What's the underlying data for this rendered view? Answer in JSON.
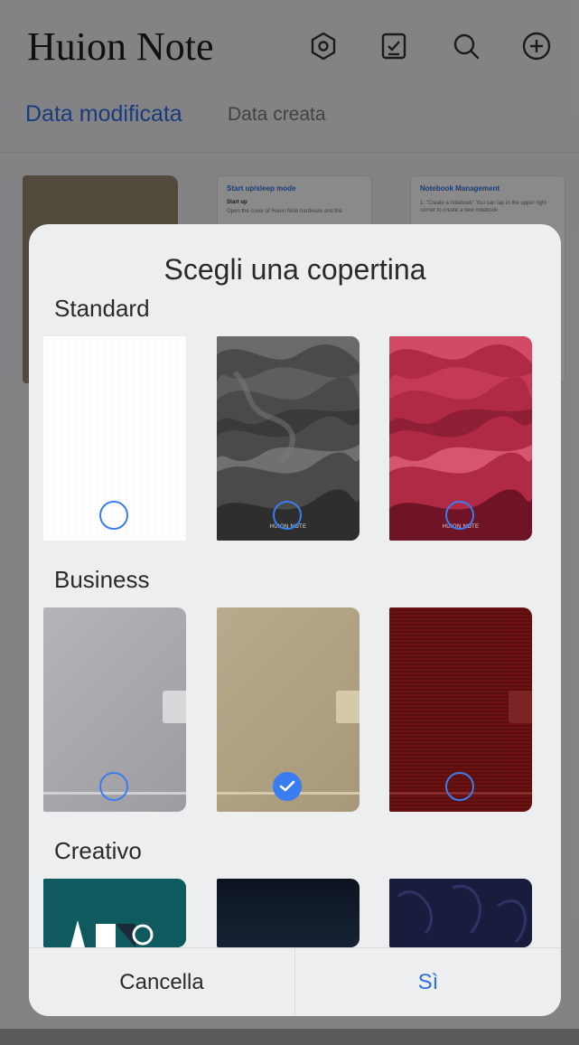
{
  "app": {
    "title": "Huion Note",
    "header_icons": [
      "settings-hex-icon",
      "task-check-icon",
      "search-icon",
      "add-circle-icon"
    ],
    "tabs": [
      {
        "label": "Data modificata",
        "active": true
      },
      {
        "label": "Data creata",
        "active": false
      }
    ],
    "notebooks": [
      {
        "kind": "cover",
        "color": "#9a8a74"
      },
      {
        "kind": "doc",
        "title": "Start up/sleep mode",
        "subtitle": "Start up",
        "text": "Open the cover of Huion Note hardware and the"
      },
      {
        "kind": "doc",
        "title": "Notebook Management",
        "subtitle": "",
        "text": "1. \"Create a notebook\" You can tap in the upper right corner to create a new notebook"
      }
    ]
  },
  "dialog": {
    "title": "Scegli una copertina",
    "sections": [
      {
        "label": "Standard"
      },
      {
        "label": "Business"
      },
      {
        "label": "Creativo"
      }
    ],
    "cover_brand": "HUION NOTE",
    "selected_cover": "business-2",
    "cancel_label": "Cancella",
    "confirm_label": "Sì"
  },
  "colors": {
    "accent": "#3a7df0",
    "link": "#2f6fe0"
  }
}
